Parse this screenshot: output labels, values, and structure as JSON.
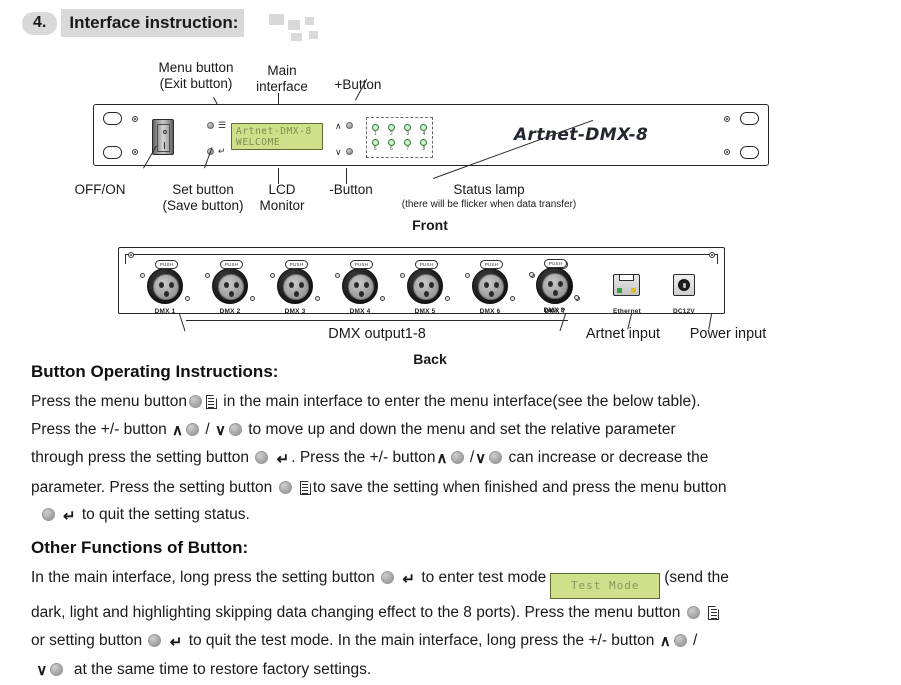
{
  "heading": {
    "number": "4.",
    "title": "Interface instruction:"
  },
  "front": {
    "caption": "Front",
    "brand": "Artnet-DMX-8",
    "lcd": {
      "line1": "Artnet-DMX-8",
      "line2": "WELCOME"
    },
    "callouts_top": [
      {
        "label": "Menu button\n(Exit button)"
      },
      {
        "label": "Main\ninterface"
      },
      {
        "label": "+Button"
      }
    ],
    "callouts_bottom": [
      {
        "label": "OFF/ON"
      },
      {
        "label": "Set button\n(Save button)"
      },
      {
        "label": "LCD\nMonitor"
      },
      {
        "label": "-Button"
      },
      {
        "label": "Status lamp"
      }
    ],
    "status_lamp_note": "(there will be flicker when  data transfer)",
    "lamp_numbers_row1": [
      "1",
      "2",
      "3",
      "4"
    ],
    "lamp_numbers_row2": [
      "5",
      "6",
      "7",
      "8"
    ],
    "push_label": "PUSH"
  },
  "back": {
    "caption": "Back",
    "ports": [
      "DMX 1",
      "DMX 2",
      "DMX 3",
      "DMX 4",
      "DMX 5",
      "DMX 6",
      "DMX 7",
      "DMX 8"
    ],
    "ethernet_label": "Ethernet",
    "dc_label": "DC12V",
    "callouts": [
      {
        "label": "DMX output1-8"
      },
      {
        "label": "Artnet input"
      },
      {
        "label": "Power input"
      }
    ]
  },
  "button_ops": {
    "heading": "Button Operating Instructions:",
    "l1a": "Press the menu button",
    "l1b": "in the main interface to enter the menu interface(see the below table).",
    "l2a": "Press the +/- button",
    "l2b": "/",
    "l2c": "to move up and down the menu and set the relative parameter",
    "l3a": "through press the setting button",
    "l3b": ". Press the +/- button",
    "l3c": "/",
    "l3d": "can increase or decrease the",
    "l4a": "parameter. Press the setting button",
    "l4b": "to save the setting when finished and press the menu button",
    "l5a": "to quit the setting status."
  },
  "other_fn": {
    "heading": "Other Functions of Button:",
    "l1a": "In the main interface, long press the setting button",
    "l1b": "to enter test mode",
    "lcd_test": "Test Mode",
    "l1c": "(send the",
    "l2a": "dark, light and highlighting skipping data changing effect to the 8 ports). Press the menu button",
    "l3a": "or setting button",
    "l3b": "to quit the test mode. In the main interface, long press the +/- button",
    "l3c": "/",
    "l4a": "at the same time to restore factory settings."
  },
  "glyphs": {
    "circle": "button-circle",
    "doc": "document-icon",
    "up": "∧",
    "down": "∨",
    "enter": "↵"
  },
  "colors": {
    "lcd_bg": "#cfe08a",
    "lcd_text": "#7f8c52",
    "heading_bg": "#d9d9d9",
    "lamp": "#2f7d32"
  }
}
